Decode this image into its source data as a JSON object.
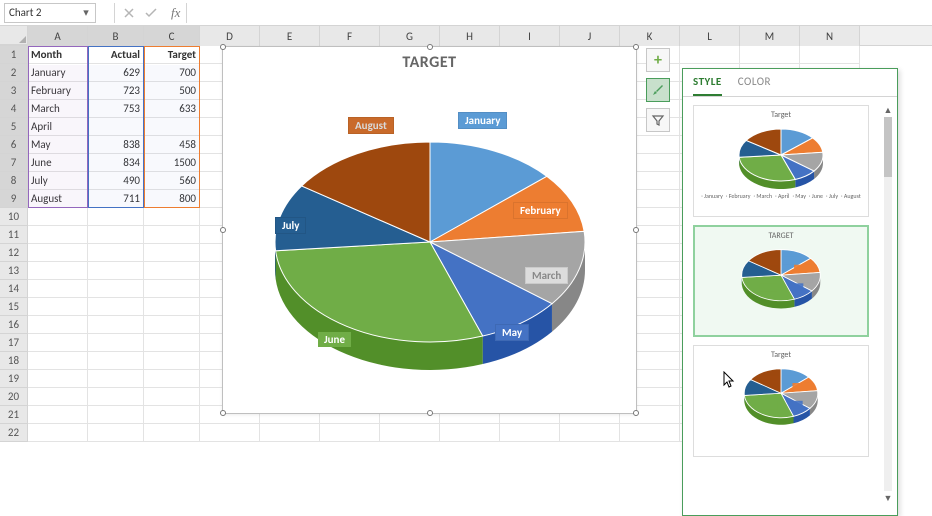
{
  "name_box": "Chart 2",
  "formula": "",
  "columns": [
    "A",
    "B",
    "C",
    "D",
    "E",
    "F",
    "G",
    "H",
    "I",
    "J",
    "K",
    "L",
    "M",
    "N"
  ],
  "row_numbers": [
    1,
    2,
    3,
    4,
    5,
    6,
    7,
    8,
    9,
    10,
    11,
    12,
    13,
    14,
    15,
    16,
    17,
    18,
    19,
    20,
    21,
    22
  ],
  "table": {
    "headers": {
      "a": "Month",
      "b": "Actual",
      "c": "Target"
    },
    "rows": [
      {
        "a": "January",
        "b": 629,
        "c": 700
      },
      {
        "a": "February",
        "b": 723,
        "c": 500
      },
      {
        "a": "March",
        "b": 753,
        "c": 633
      },
      {
        "a": "April",
        "b": "",
        "c": ""
      },
      {
        "a": "May",
        "b": 838,
        "c": 458
      },
      {
        "a": "June",
        "b": 834,
        "c": 1500
      },
      {
        "a": "July",
        "b": 490,
        "c": 560
      },
      {
        "a": "August",
        "b": 711,
        "c": 800
      }
    ]
  },
  "chart_data": {
    "type": "pie",
    "title": "TARGET",
    "categories": [
      "January",
      "February",
      "March",
      "April",
      "May",
      "June",
      "July",
      "August"
    ],
    "values": [
      700,
      500,
      633,
      0,
      458,
      1500,
      560,
      800
    ],
    "colors": {
      "January": "#5b9bd5",
      "February": "#ed7d31",
      "March": "#a5a5a5",
      "April": "#ffc000",
      "May": "#4472c4",
      "June": "#70ad47",
      "July": "#255e91",
      "August": "#9e480e"
    }
  },
  "side_buttons": {
    "plus": "+",
    "brush": "brush-icon",
    "filter": "filter-icon"
  },
  "gallery": {
    "tabs": {
      "style": "STYLE",
      "color": "COLOR"
    },
    "thumbs": [
      {
        "title": "Target",
        "legend": [
          "January",
          "February",
          "March",
          "April",
          "May",
          "June",
          "July",
          "August"
        ]
      },
      {
        "title": "TARGET"
      },
      {
        "title": "Target"
      }
    ]
  }
}
